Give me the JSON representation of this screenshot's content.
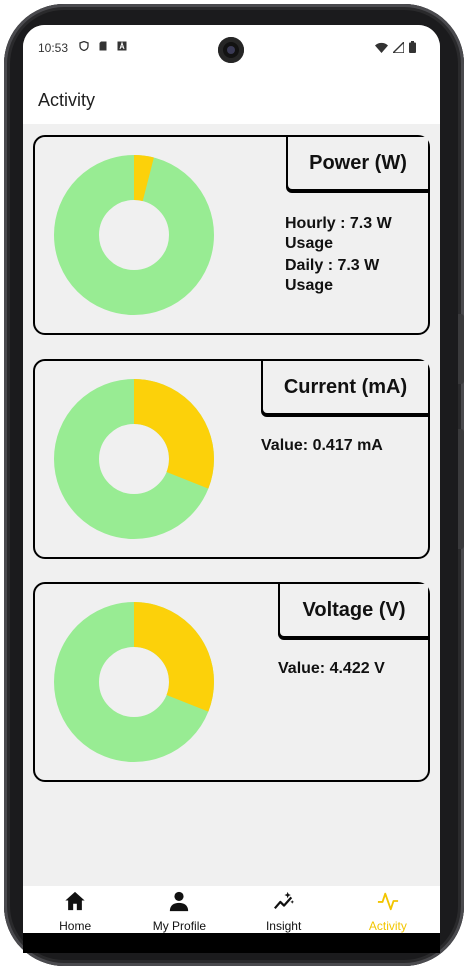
{
  "status_bar": {
    "time": "10:53",
    "left_icons": [
      "shield-icon",
      "sd-card-icon",
      "font-icon"
    ],
    "right_icons": [
      "wifi-icon",
      "signal-icon",
      "battery-icon"
    ]
  },
  "header": {
    "title": "Activity"
  },
  "cards": {
    "power": {
      "title": "Power (W)",
      "hourly": "Hourly : 7.3 W Usage",
      "daily": "Daily : 7.3 W Usage",
      "donut_fraction": 0.04
    },
    "current": {
      "title": "Current (mA)",
      "value": "Value: 0.417 mA",
      "donut_fraction": 0.31
    },
    "voltage": {
      "title": "Voltage (V)",
      "value": "Value: 4.422 V",
      "donut_fraction": 0.31
    }
  },
  "colors": {
    "donut_base": "#98ec93",
    "donut_highlight": "#fcd10a",
    "active_nav": "#f2c500"
  },
  "bottom_nav": {
    "items": [
      {
        "label": "Home",
        "icon": "home-icon"
      },
      {
        "label": "My Profile",
        "icon": "person-icon"
      },
      {
        "label": "Insight",
        "icon": "insight-icon"
      },
      {
        "label": "Activity",
        "icon": "activity-icon"
      }
    ],
    "active": "Activity"
  }
}
